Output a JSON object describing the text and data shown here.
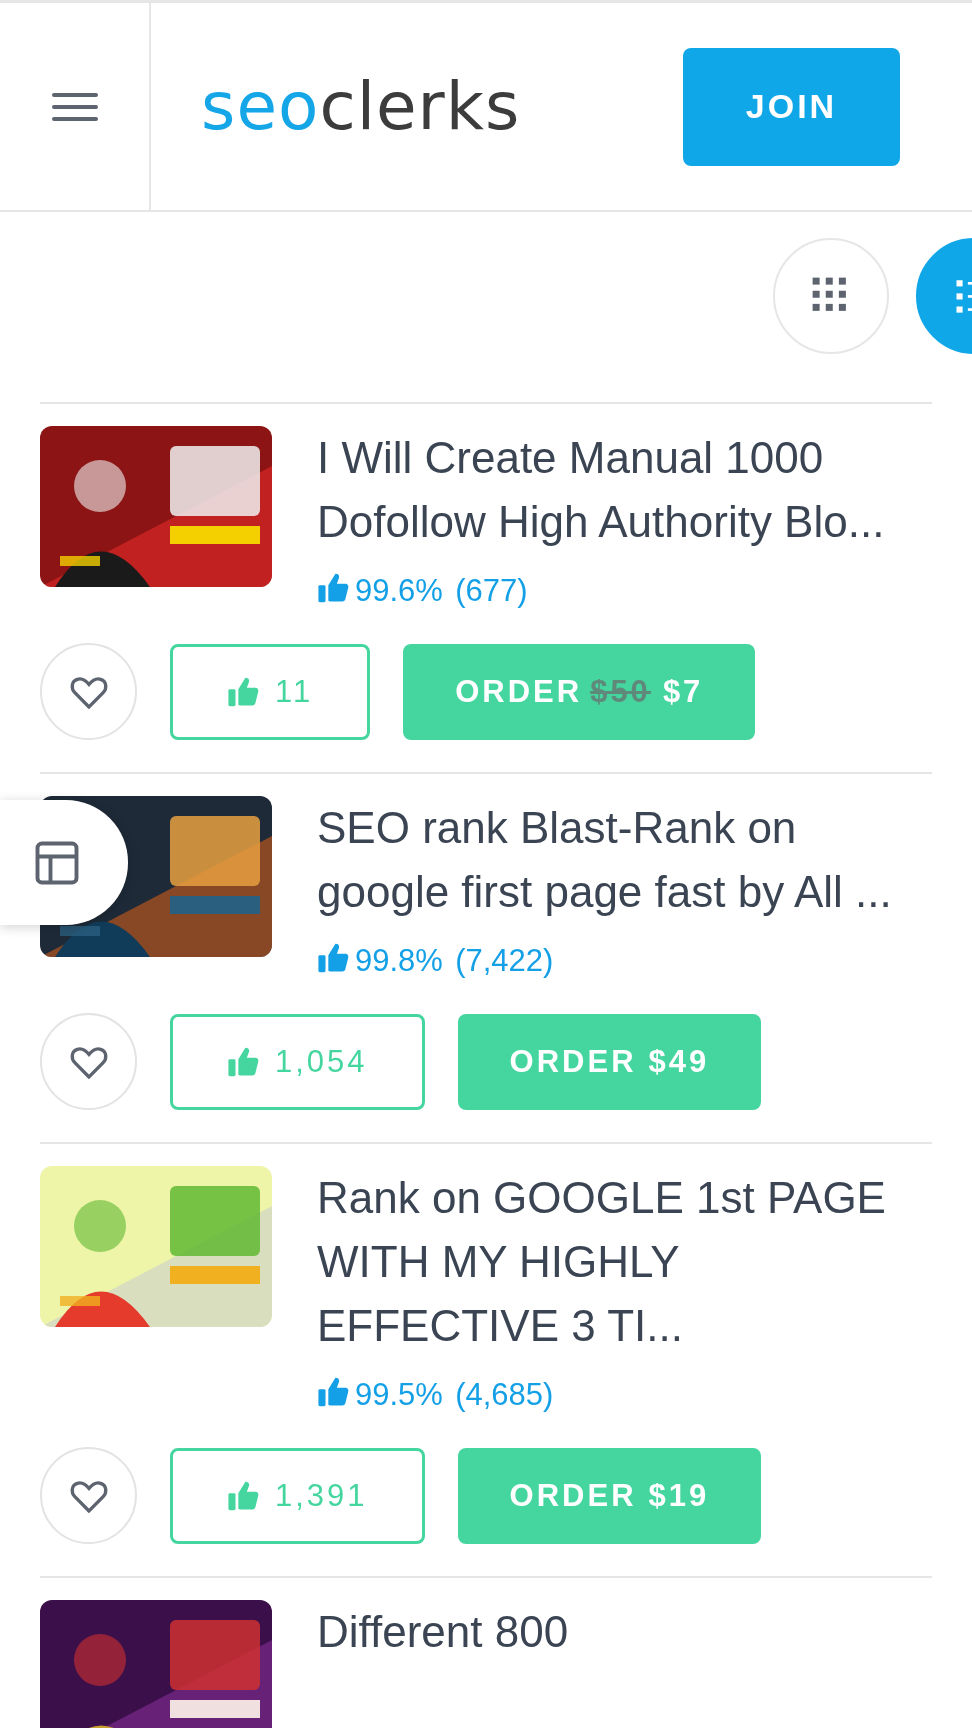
{
  "header": {
    "logo": {
      "part_1": "seo",
      "part_2": "clerks"
    },
    "join_button": "JOIN"
  },
  "view_toggle": [
    {
      "kind": "grid",
      "selected": false
    },
    {
      "kind": "list",
      "selected": true
    }
  ],
  "listings": [
    {
      "title": "I Will Create Manual 1000 Dofollow High Authority Blo...",
      "rating": {
        "percent": "99.6%",
        "count": "(677)"
      },
      "likes": "11",
      "order": {
        "label": "ORDER",
        "old_price": "$50",
        "price": "$7"
      }
    },
    {
      "title": "SEO rank Blast-Rank on google first page fast by All ...",
      "rating": {
        "percent": "99.8%",
        "count": "(7,422)"
      },
      "likes": "1,054",
      "order": {
        "label": "ORDER",
        "price": "$49"
      }
    },
    {
      "title": "Rank on GOOGLE 1st PAGE WITH MY HIGHLY EFFECTIVE 3 TI...",
      "rating": {
        "percent": "99.5%",
        "count": "(4,685)"
      },
      "likes": "1,391",
      "order": {
        "label": "ORDER",
        "price": "$19"
      }
    },
    {
      "title": "Different 800"
    }
  ]
}
